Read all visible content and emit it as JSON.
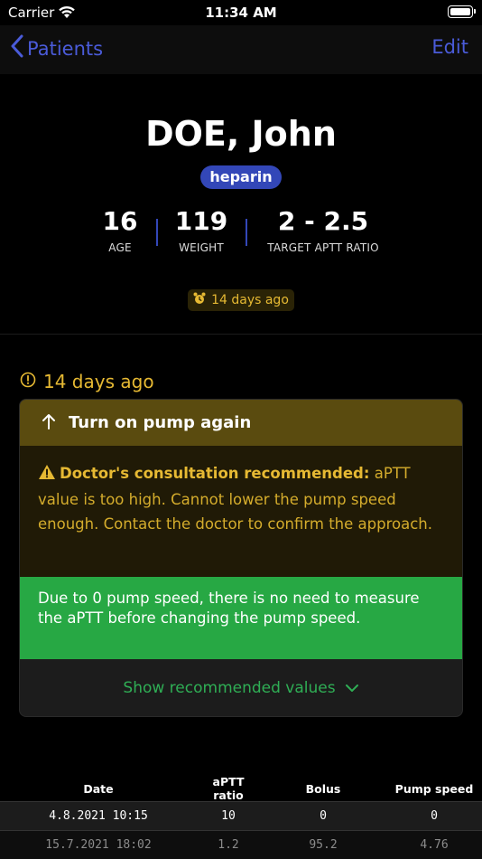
{
  "status_bar": {
    "carrier": "Carrier",
    "time": "11:34 AM"
  },
  "nav": {
    "back_label": "Patients",
    "edit_label": "Edit"
  },
  "patient": {
    "name": "DOE, John",
    "drug": "heparin",
    "age": {
      "value": "16",
      "label": "AGE"
    },
    "weight": {
      "value": "119",
      "label": "WEIGHT"
    },
    "target": {
      "value": "2 - 2.5",
      "label": "TARGET APTT RATIO"
    },
    "last_update": "14 days ago"
  },
  "recommendation": {
    "time": "14 days ago",
    "title": "Turn on pump again",
    "warning_title": "Doctor's consultation recommended:",
    "warning_text": "aPTT value is too high. Cannot lower the pump speed enough. Contact the doctor to confirm the approach.",
    "info_text": "Due to 0 pump speed, there is no need to measure the aPTT before changing the pump speed.",
    "show_values_label": "Show recommended values"
  },
  "table": {
    "headers": [
      "Date",
      "aPTT ratio",
      "Bolus",
      "Pump speed"
    ],
    "rows": [
      [
        "4.8.2021 10:15",
        "10",
        "0",
        "0"
      ],
      [
        "15.7.2021 18:02",
        "1.2",
        "95.2",
        "4.76"
      ]
    ]
  },
  "colors": {
    "accent": "#4a5bd9",
    "badge": "#3347b8",
    "warning": "#e6b933",
    "success": "#27a844"
  },
  "icons": [
    "wifi-icon",
    "battery-icon",
    "chevron-left-icon",
    "alarm-clock-icon",
    "clock-alert-icon",
    "arrow-up-icon",
    "warning-triangle-icon",
    "chevron-down-icon"
  ]
}
